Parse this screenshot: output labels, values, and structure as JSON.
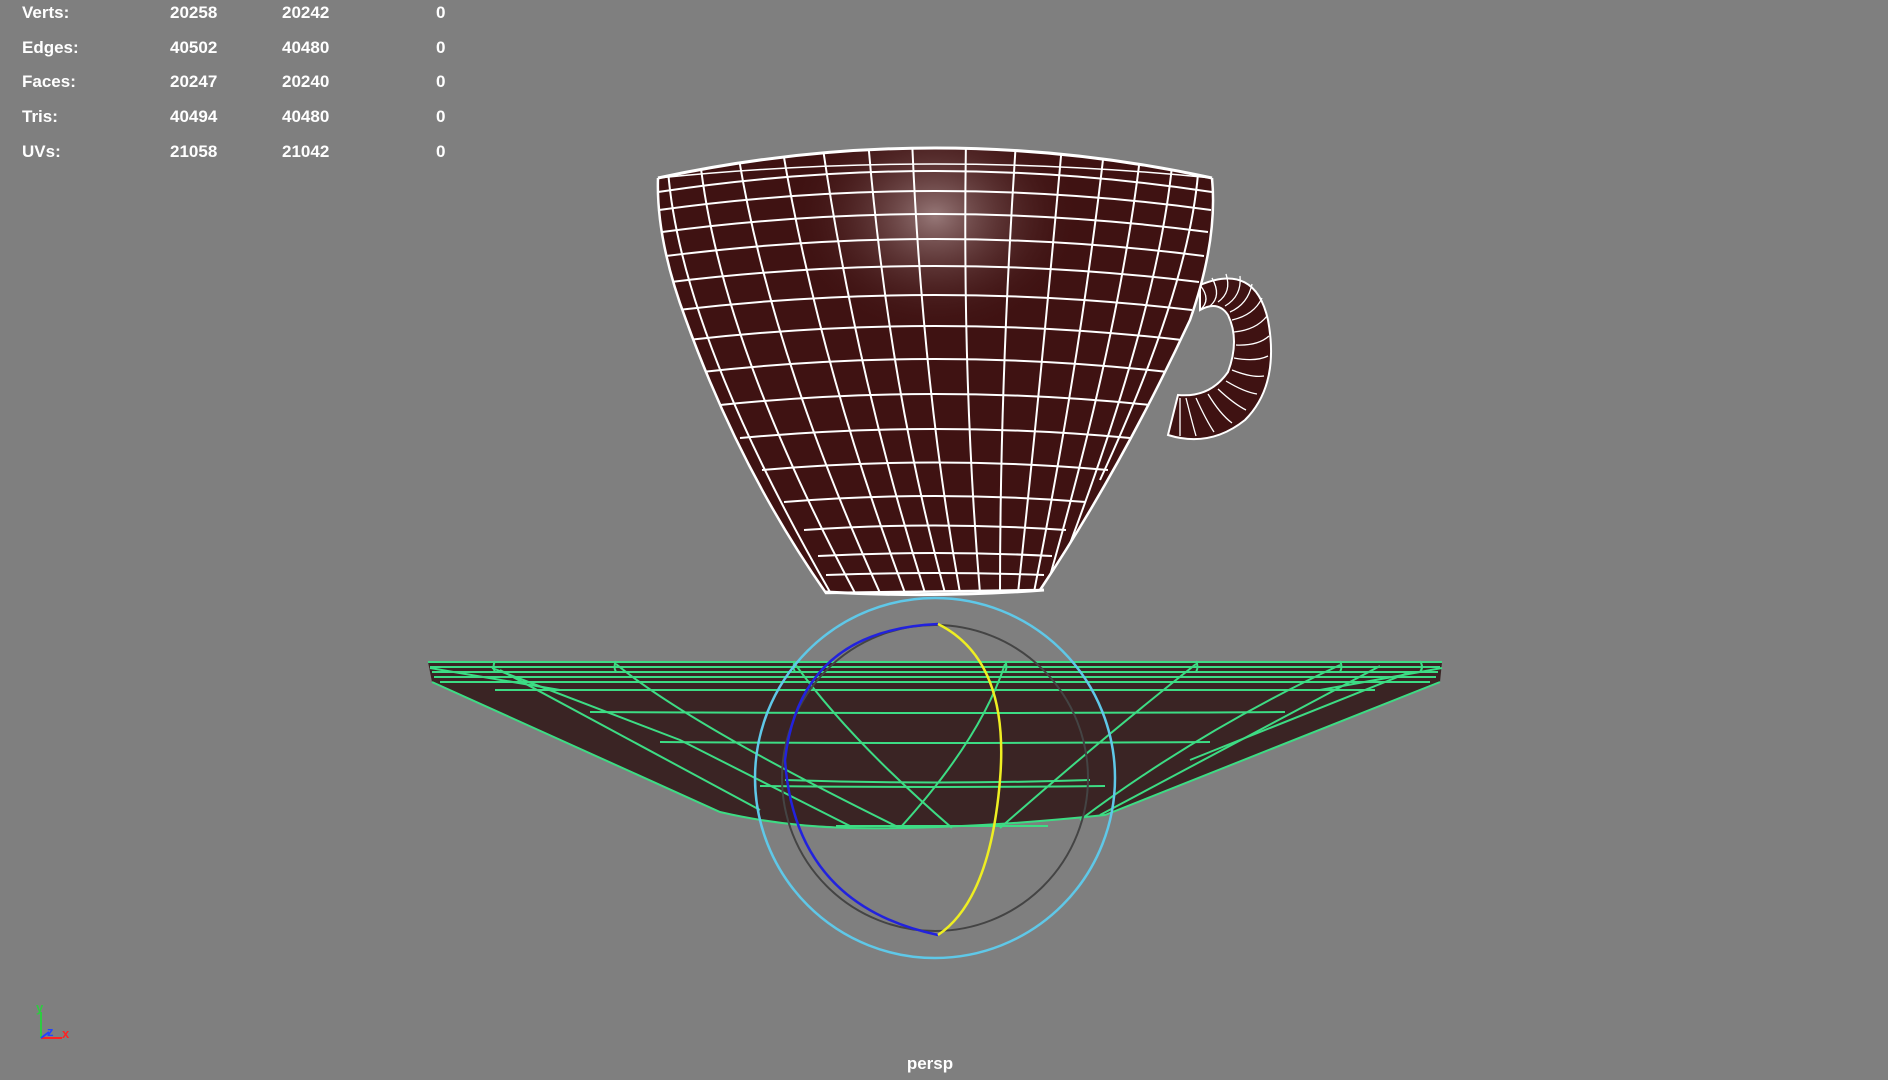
{
  "viewport": {
    "camera_name": "persp",
    "background_color": "#7f7f7f"
  },
  "stats": [
    {
      "label": "Verts:",
      "values": [
        "20258",
        "20242",
        "0"
      ]
    },
    {
      "label": "Edges:",
      "values": [
        "40502",
        "40480",
        "0"
      ]
    },
    {
      "label": "Faces:",
      "values": [
        "20247",
        "20240",
        "0"
      ]
    },
    {
      "label": "Tris:",
      "values": [
        "40494",
        "40480",
        "0"
      ]
    },
    {
      "label": "UVs:",
      "values": [
        "21058",
        "21042",
        "0"
      ]
    }
  ],
  "axis_indicator": {
    "y_label": "y",
    "z_label": "z",
    "x_label": "x",
    "y_color": "#2ecc40",
    "z_color": "#2244ff",
    "x_color": "#ff2222"
  },
  "objects": {
    "cup": {
      "fill_color": "#3f1212",
      "wire_color": "#ffffff"
    },
    "saucer": {
      "fill_color": "#3a2424",
      "wire_color": "#3ddc84"
    },
    "rotate_manipulator": {
      "outer_color": "#5fc8e8",
      "x_color": "#2222dd",
      "y_color": "#eeee22",
      "inner_color": "#444444"
    }
  }
}
